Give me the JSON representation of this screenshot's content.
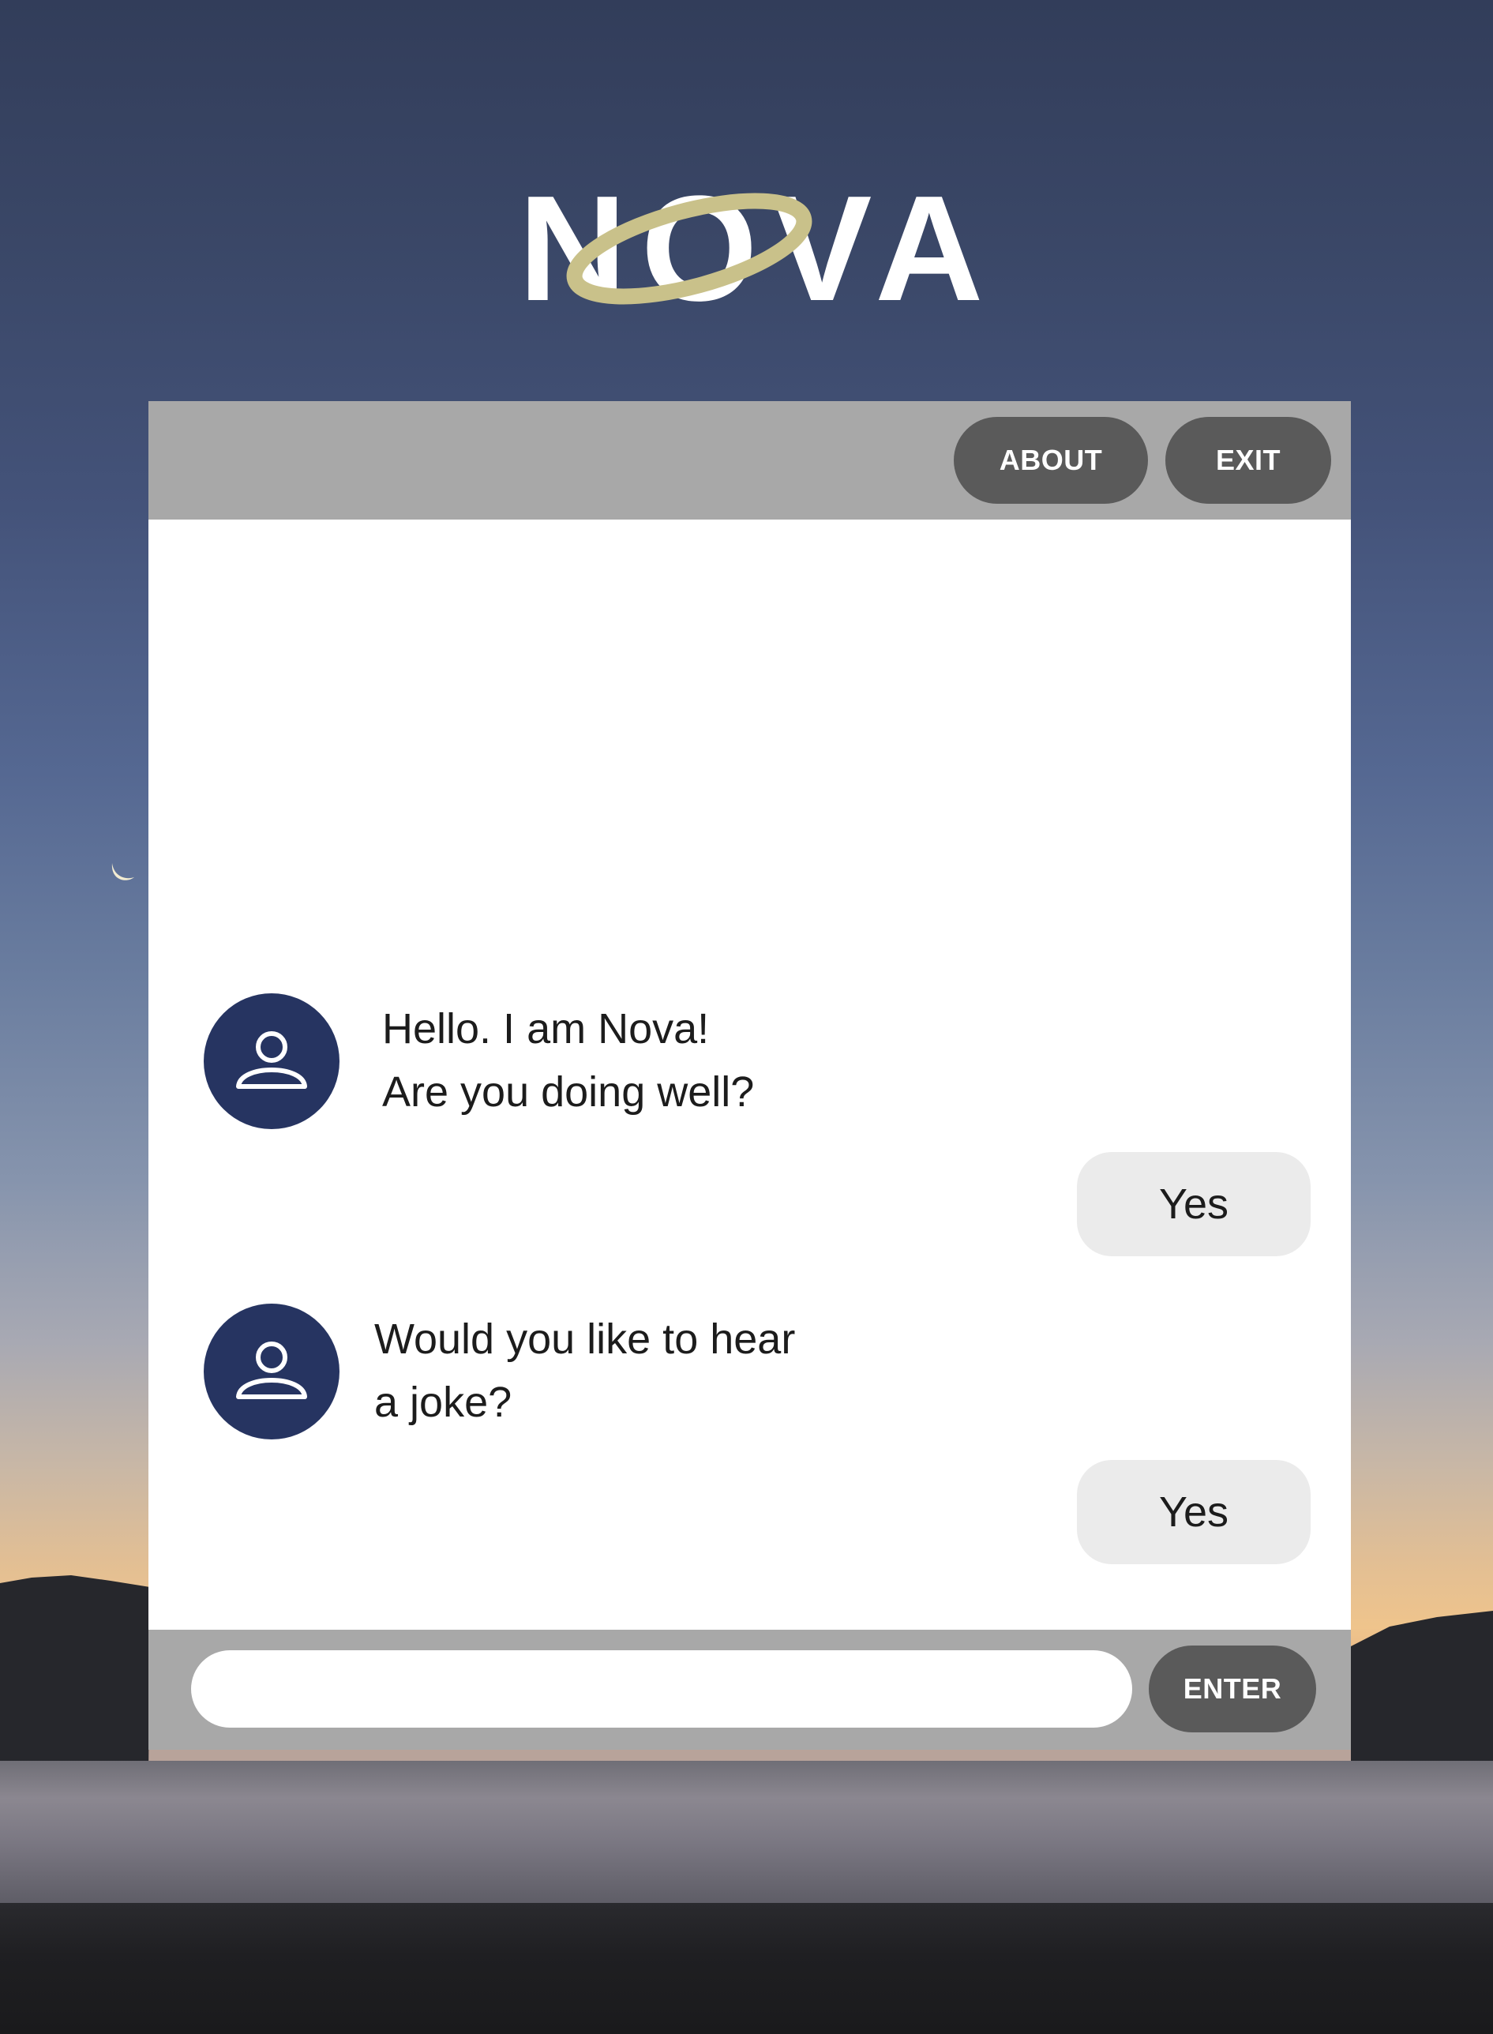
{
  "app": {
    "logo_text": "NOVA"
  },
  "header": {
    "about_label": "ABOUT",
    "exit_label": "EXIT"
  },
  "conversation": [
    {
      "sender": "bot",
      "text": "Hello. I am Nova!\nAre you doing well?"
    },
    {
      "sender": "user",
      "text": "Yes"
    },
    {
      "sender": "bot",
      "text": "Would you like to hear\na joke?"
    },
    {
      "sender": "user",
      "text": "Yes"
    }
  ],
  "composer": {
    "input_value": "",
    "input_placeholder": "",
    "enter_label": "ENTER"
  },
  "colors": {
    "bar_gray": "#a8a8a8",
    "button_dark": "#5a5a5a",
    "avatar_navy": "#263461",
    "user_bubble": "#ebebeb",
    "logo_ring": "#c9c18a"
  },
  "icons": {
    "avatar": "user-outline-icon",
    "logo_ring": "saturn-ring"
  }
}
